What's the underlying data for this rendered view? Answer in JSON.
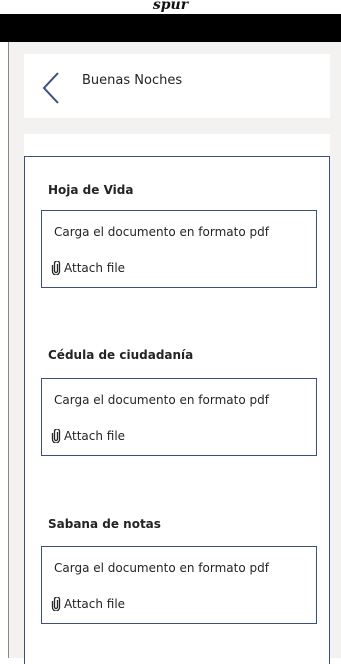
{
  "banner": {
    "title": "spur"
  },
  "header": {
    "title": "Buenas Noches"
  },
  "form": {
    "fields": [
      {
        "label": "Hoja de Vida",
        "hint": "Carga el documento en formato pdf",
        "attach_label": "Attach file"
      },
      {
        "label": "Cédula de ciudadanía",
        "hint": "Carga el documento en formato pdf",
        "attach_label": "Attach file"
      },
      {
        "label": "Sabana de notas",
        "hint": "Carga el documento en formato pdf",
        "attach_label": "Attach file"
      }
    ]
  },
  "colors": {
    "accent_border": "#3b4f81",
    "app_background": "#f3f2f1",
    "card": "#ffffff",
    "top_bar": "#000000"
  },
  "icons": {
    "back": "chevron-left-icon",
    "attach": "paperclip-icon"
  }
}
